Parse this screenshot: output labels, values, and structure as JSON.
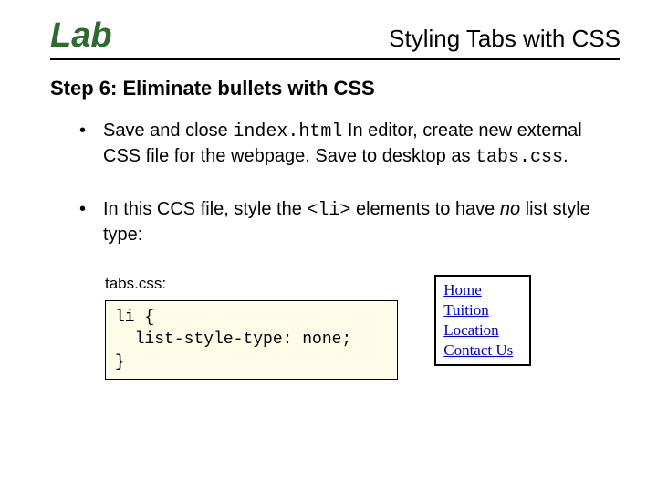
{
  "header": {
    "lab": "Lab",
    "title": "Styling Tabs with CSS"
  },
  "step_heading": "Step 6:  Eliminate bullets with CSS",
  "bullet1": {
    "pre": "Save and close ",
    "code": "index.html",
    "mid": "  In editor, create new external CSS file for the webpage. Save to desktop as ",
    "code2": "tabs.css",
    "post": "."
  },
  "bullet2": {
    "pre": "In this CCS file, style the ",
    "code": "<li>",
    "mid": " elements to have ",
    "em": "no",
    "post": " list style type:"
  },
  "code": {
    "label": "tabs.css:",
    "body": "li {\n  list-style-type: none;\n}"
  },
  "links": [
    "Home",
    "Tuition",
    "Location",
    "Contact Us"
  ]
}
